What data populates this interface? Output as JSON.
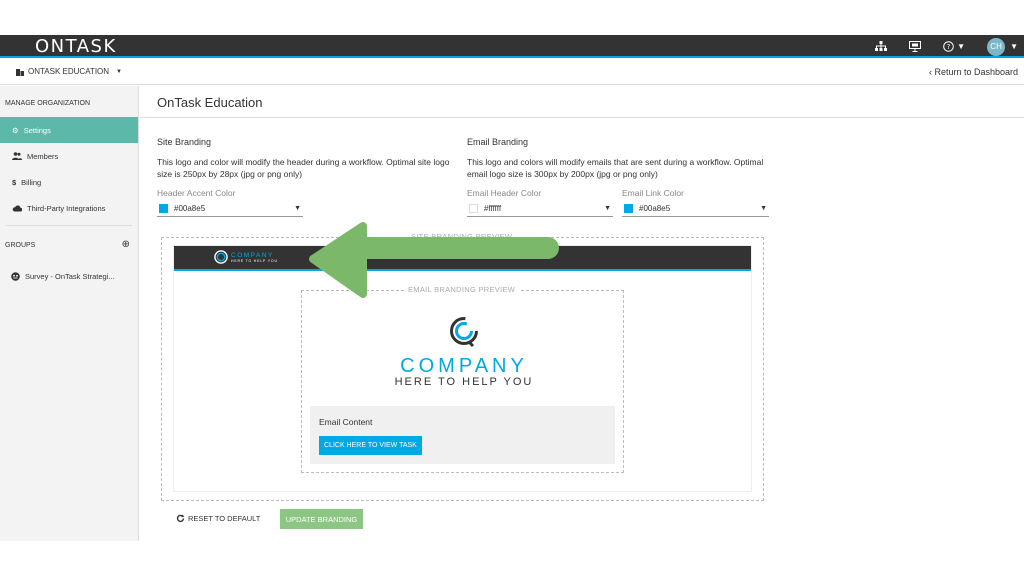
{
  "app": {
    "logo_text": "ONTASK"
  },
  "topbar": {
    "icons": [
      "sitemap-icon",
      "presentation-icon",
      "help-icon"
    ],
    "avatar_initials": "CH"
  },
  "subbar": {
    "org_name": "ONTASK EDUCATION",
    "return_link": "‹  Return to Dashboard"
  },
  "sidebar": {
    "manage_heading": "MANAGE ORGANIZATION",
    "items": [
      {
        "label": "Settings",
        "icon": "gear-icon",
        "active": true
      },
      {
        "label": "Members",
        "icon": "users-icon"
      },
      {
        "label": "Billing",
        "icon": "dollar-icon"
      },
      {
        "label": "Third-Party Integrations",
        "icon": "cloud-icon"
      }
    ],
    "groups_heading": "GROUPS",
    "groups": [
      {
        "label": "Survey - OnTask Strategi..."
      }
    ]
  },
  "main": {
    "title": "OnTask Education",
    "site_branding": {
      "heading": "Site Branding",
      "description": "This logo and color will modify the header during a workflow. Optimal site logo size is 250px by 28px (jpg or png only)",
      "accent_label": "Header Accent Color",
      "accent_value": "#00a8e5",
      "accent_color": "#00a8e5"
    },
    "email_branding": {
      "heading": "Email Branding",
      "description": "This logo and colors will modify emails that are sent during a workflow. Optimal email logo size is 300px by 200px (jpg or png only)",
      "header_label": "Email Header Color",
      "header_value": "#ffffff",
      "header_color": "#ffffff",
      "link_label": "Email Link Color",
      "link_value": "#00a8e5",
      "link_color": "#00a8e5"
    },
    "site_preview": {
      "legend": "SITE BRANDING PREVIEW",
      "logo_company": "COMPANY",
      "logo_tagline": "HERE TO HELP YOU"
    },
    "email_preview": {
      "legend": "EMAIL BRANDING PREVIEW",
      "logo_company": "COMPANY",
      "logo_tagline": "HERE TO HELP YOU",
      "content_label": "Email Content",
      "cta_label": "CLICK HERE TO VIEW TASK"
    },
    "actions": {
      "reset_label": "RESET TO DEFAULT",
      "update_label": "UPDATE BRANDING"
    }
  },
  "colors": {
    "accent": "#00a8e5",
    "topbar": "#333333",
    "sidebar_active": "#5cb8a8",
    "update_button": "#8bc682",
    "arrow": "#7cb86a"
  }
}
